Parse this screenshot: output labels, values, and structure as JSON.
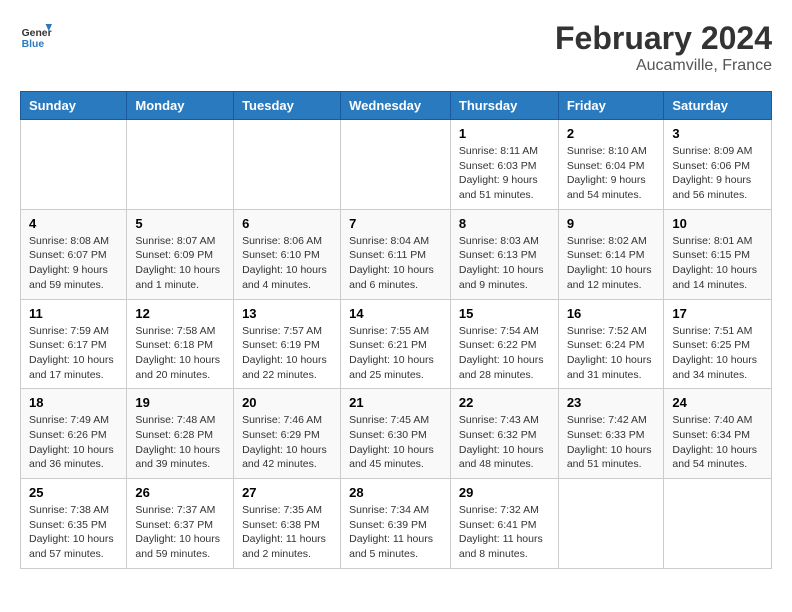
{
  "header": {
    "logo_line1": "General",
    "logo_line2": "Blue",
    "month_title": "February 2024",
    "location": "Aucamville, France"
  },
  "days_of_week": [
    "Sunday",
    "Monday",
    "Tuesday",
    "Wednesday",
    "Thursday",
    "Friday",
    "Saturday"
  ],
  "weeks": [
    [
      {
        "day": "",
        "info": ""
      },
      {
        "day": "",
        "info": ""
      },
      {
        "day": "",
        "info": ""
      },
      {
        "day": "",
        "info": ""
      },
      {
        "day": "1",
        "info": "Sunrise: 8:11 AM\nSunset: 6:03 PM\nDaylight: 9 hours and 51 minutes."
      },
      {
        "day": "2",
        "info": "Sunrise: 8:10 AM\nSunset: 6:04 PM\nDaylight: 9 hours and 54 minutes."
      },
      {
        "day": "3",
        "info": "Sunrise: 8:09 AM\nSunset: 6:06 PM\nDaylight: 9 hours and 56 minutes."
      }
    ],
    [
      {
        "day": "4",
        "info": "Sunrise: 8:08 AM\nSunset: 6:07 PM\nDaylight: 9 hours and 59 minutes."
      },
      {
        "day": "5",
        "info": "Sunrise: 8:07 AM\nSunset: 6:09 PM\nDaylight: 10 hours and 1 minute."
      },
      {
        "day": "6",
        "info": "Sunrise: 8:06 AM\nSunset: 6:10 PM\nDaylight: 10 hours and 4 minutes."
      },
      {
        "day": "7",
        "info": "Sunrise: 8:04 AM\nSunset: 6:11 PM\nDaylight: 10 hours and 6 minutes."
      },
      {
        "day": "8",
        "info": "Sunrise: 8:03 AM\nSunset: 6:13 PM\nDaylight: 10 hours and 9 minutes."
      },
      {
        "day": "9",
        "info": "Sunrise: 8:02 AM\nSunset: 6:14 PM\nDaylight: 10 hours and 12 minutes."
      },
      {
        "day": "10",
        "info": "Sunrise: 8:01 AM\nSunset: 6:15 PM\nDaylight: 10 hours and 14 minutes."
      }
    ],
    [
      {
        "day": "11",
        "info": "Sunrise: 7:59 AM\nSunset: 6:17 PM\nDaylight: 10 hours and 17 minutes."
      },
      {
        "day": "12",
        "info": "Sunrise: 7:58 AM\nSunset: 6:18 PM\nDaylight: 10 hours and 20 minutes."
      },
      {
        "day": "13",
        "info": "Sunrise: 7:57 AM\nSunset: 6:19 PM\nDaylight: 10 hours and 22 minutes."
      },
      {
        "day": "14",
        "info": "Sunrise: 7:55 AM\nSunset: 6:21 PM\nDaylight: 10 hours and 25 minutes."
      },
      {
        "day": "15",
        "info": "Sunrise: 7:54 AM\nSunset: 6:22 PM\nDaylight: 10 hours and 28 minutes."
      },
      {
        "day": "16",
        "info": "Sunrise: 7:52 AM\nSunset: 6:24 PM\nDaylight: 10 hours and 31 minutes."
      },
      {
        "day": "17",
        "info": "Sunrise: 7:51 AM\nSunset: 6:25 PM\nDaylight: 10 hours and 34 minutes."
      }
    ],
    [
      {
        "day": "18",
        "info": "Sunrise: 7:49 AM\nSunset: 6:26 PM\nDaylight: 10 hours and 36 minutes."
      },
      {
        "day": "19",
        "info": "Sunrise: 7:48 AM\nSunset: 6:28 PM\nDaylight: 10 hours and 39 minutes."
      },
      {
        "day": "20",
        "info": "Sunrise: 7:46 AM\nSunset: 6:29 PM\nDaylight: 10 hours and 42 minutes."
      },
      {
        "day": "21",
        "info": "Sunrise: 7:45 AM\nSunset: 6:30 PM\nDaylight: 10 hours and 45 minutes."
      },
      {
        "day": "22",
        "info": "Sunrise: 7:43 AM\nSunset: 6:32 PM\nDaylight: 10 hours and 48 minutes."
      },
      {
        "day": "23",
        "info": "Sunrise: 7:42 AM\nSunset: 6:33 PM\nDaylight: 10 hours and 51 minutes."
      },
      {
        "day": "24",
        "info": "Sunrise: 7:40 AM\nSunset: 6:34 PM\nDaylight: 10 hours and 54 minutes."
      }
    ],
    [
      {
        "day": "25",
        "info": "Sunrise: 7:38 AM\nSunset: 6:35 PM\nDaylight: 10 hours and 57 minutes."
      },
      {
        "day": "26",
        "info": "Sunrise: 7:37 AM\nSunset: 6:37 PM\nDaylight: 10 hours and 59 minutes."
      },
      {
        "day": "27",
        "info": "Sunrise: 7:35 AM\nSunset: 6:38 PM\nDaylight: 11 hours and 2 minutes."
      },
      {
        "day": "28",
        "info": "Sunrise: 7:34 AM\nSunset: 6:39 PM\nDaylight: 11 hours and 5 minutes."
      },
      {
        "day": "29",
        "info": "Sunrise: 7:32 AM\nSunset: 6:41 PM\nDaylight: 11 hours and 8 minutes."
      },
      {
        "day": "",
        "info": ""
      },
      {
        "day": "",
        "info": ""
      }
    ]
  ]
}
